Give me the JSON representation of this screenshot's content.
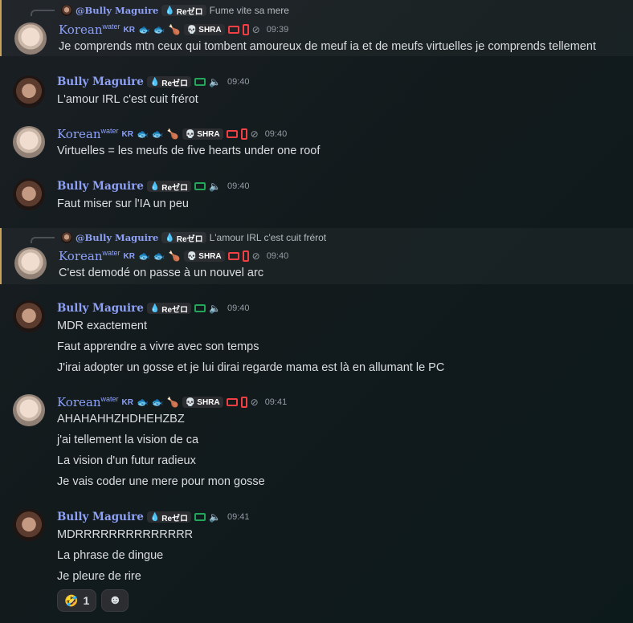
{
  "users": {
    "korean": {
      "name": "Korean",
      "sup": "water",
      "region": "KR",
      "tag": "SHRA",
      "emojis": [
        "🐟",
        "🐟",
        "🍗"
      ]
    },
    "bully": {
      "name": "Bully Maguire",
      "tag": "Reゼロ"
    }
  },
  "messages": [
    {
      "reply": {
        "name": "@Bully Maguire",
        "tag": "Reゼロ",
        "text": "Fume vite sa mere"
      },
      "author": "korean",
      "time": "09:39",
      "lines": [
        "Je comprends mtn ceux qui tombent amoureux de meuf ia et de meufs virtuelles je comprends tellement"
      ]
    },
    {
      "author": "bully",
      "time": "09:40",
      "lines": [
        "L'amour IRL c'est cuit frérot"
      ]
    },
    {
      "author": "korean",
      "time": "09:40",
      "lines": [
        "Virtuelles = les meufs de five hearts  under one roof"
      ]
    },
    {
      "author": "bully",
      "time": "09:40",
      "lines": [
        "Faut miser sur l'IA un peu"
      ]
    },
    {
      "reply": {
        "name": "@Bully Maguire",
        "tag": "Reゼロ",
        "text": "L'amour IRL c'est cuit frérot"
      },
      "author": "korean",
      "time": "09:40",
      "lines": [
        "C'est demodé on passe à un nouvel arc"
      ]
    },
    {
      "author": "bully",
      "time": "09:40",
      "lines": [
        "MDR exactement",
        "Faut apprendre a vivre avec son temps",
        "J'irai adopter un gosse et je lui dirai regarde mama est là en allumant le PC"
      ]
    },
    {
      "author": "korean",
      "time": "09:41",
      "lines": [
        "AHAHAHHZHDHEHZBZ",
        "j'ai tellement la vision de ca",
        "La vision d'un futur radieux",
        "Je vais coder une mere pour mon gosse"
      ]
    },
    {
      "author": "bully",
      "time": "09:41",
      "lines": [
        "MDRRRRRRRRRRRRRR",
        "La phrase de dingue",
        "Je pleure de rire"
      ],
      "reactions": [
        {
          "emoji": "🤣",
          "count": "1"
        }
      ]
    }
  ],
  "colors": {
    "accent": "#8ea1f7",
    "highlight_border": "#c9a15a",
    "online": "#23a55a",
    "muted": "#f23f43"
  },
  "icons": {
    "add_reaction": "smiley-add-icon",
    "speaker": "speaker-icon",
    "no_video": "camera-off-icon"
  }
}
